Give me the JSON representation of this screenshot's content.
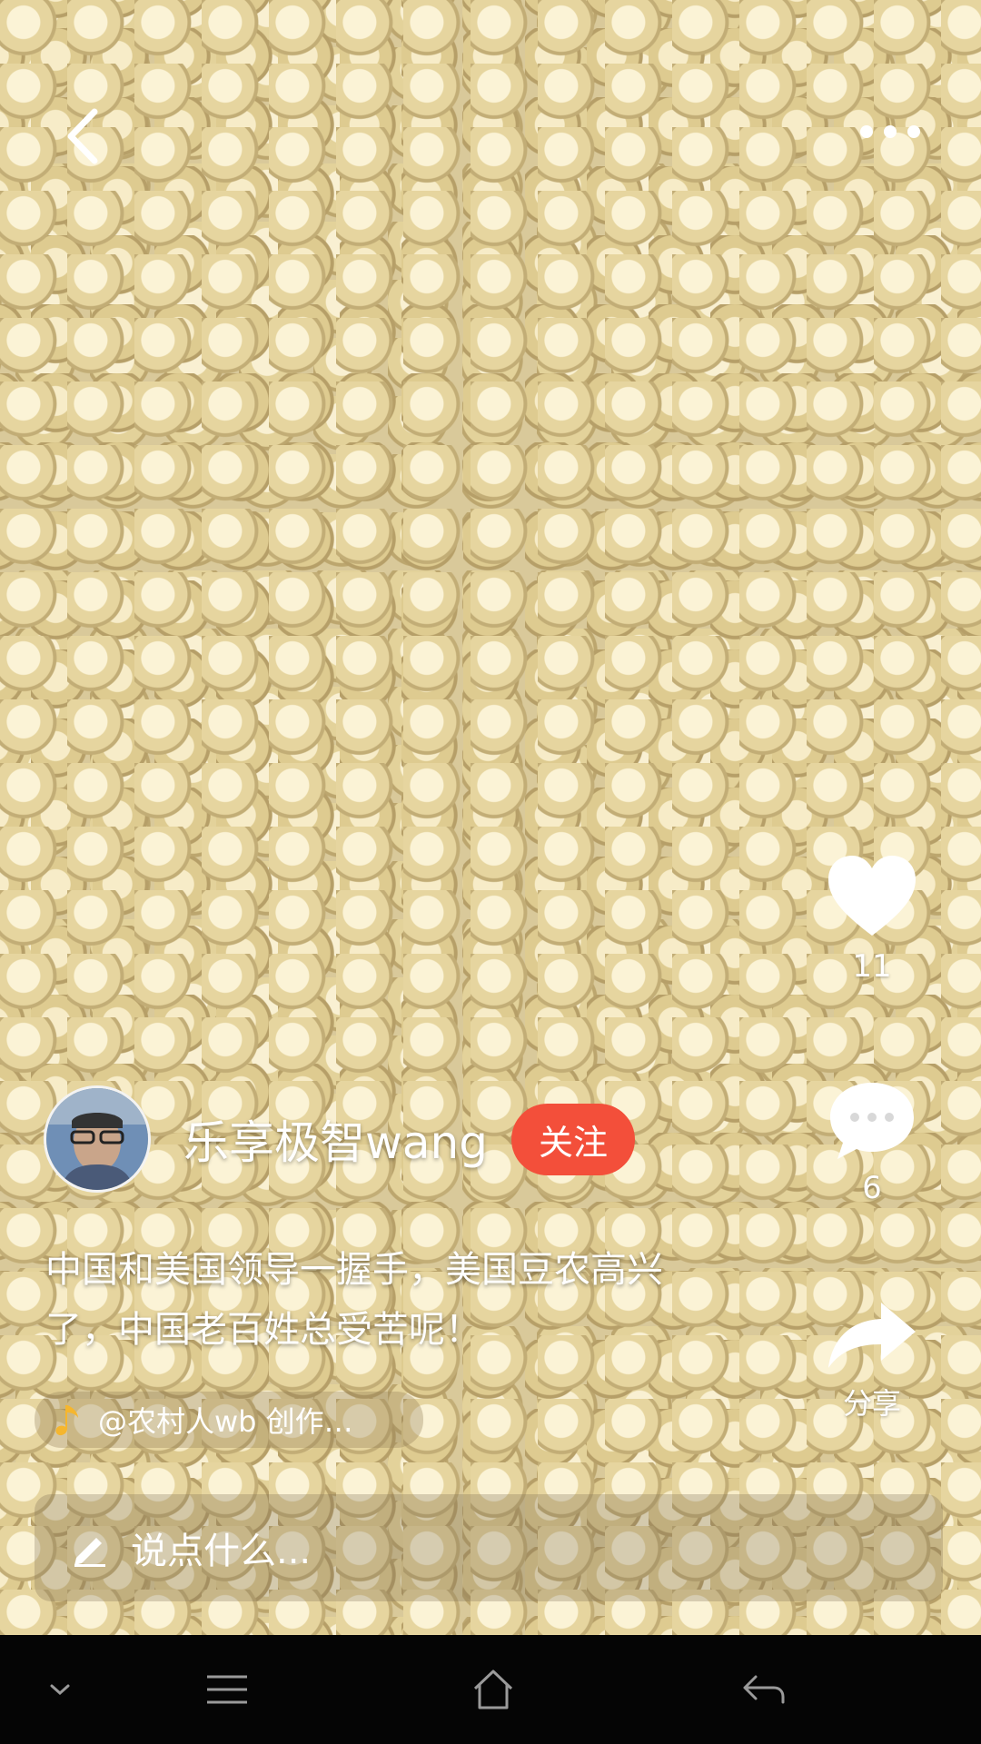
{
  "post": {
    "author": {
      "name": "乐享极智wang",
      "follow_label": "关注"
    },
    "caption": "中国和美国领导一握手，美国豆农高兴了，中国老百姓总受苦呢！",
    "music_text": "@农村人wb 创作…"
  },
  "actions": {
    "like_count": "11",
    "comment_count": "6",
    "share_label": "分享"
  },
  "comment_input": {
    "placeholder": "说点什么..."
  },
  "colors": {
    "follow_button": "#f34f3a",
    "music_note": "#f5b62e"
  },
  "icons": {
    "topbar": [
      "back-chevron-icon",
      "more-dots-icon"
    ],
    "side": [
      "heart-icon",
      "comment-bubble-icon",
      "share-arrow-icon"
    ],
    "nav": [
      "collapse-chevron-icon",
      "menu-lines-icon",
      "home-icon",
      "back-arrow-icon"
    ]
  }
}
